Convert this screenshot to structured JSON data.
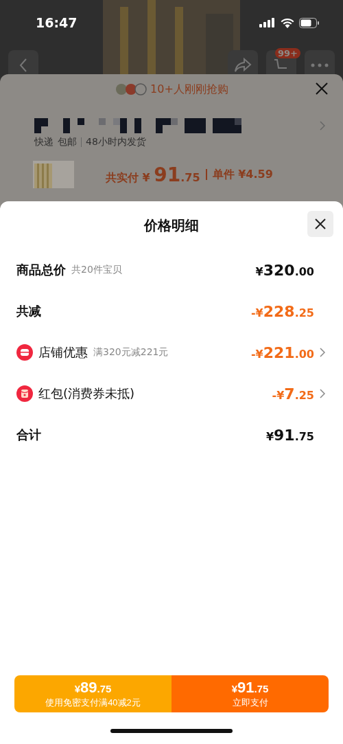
{
  "status_bar": {
    "time": "16:47"
  },
  "nav": {
    "cart_badge": "99+"
  },
  "background_sheet": {
    "social_proof": "10+人刚刚抢购",
    "tags": [
      "快递",
      "包邮"
    ],
    "shipping": "48小时内发货",
    "price_label": "共实付",
    "price": {
      "prefix": "¥",
      "integer": "91",
      "decimal": ".75"
    },
    "unit_label": "单件",
    "unit_price": "¥4.59"
  },
  "sheet": {
    "title": "价格明细",
    "rows": [
      {
        "kind": "plain",
        "label": "商品总价",
        "note": "共20件宝贝",
        "amount": {
          "prefix": "¥",
          "integer": "320",
          "decimal": ".00"
        },
        "highlight": false,
        "chevron": false
      },
      {
        "kind": "plain",
        "label": "共减",
        "amount": {
          "prefix": "-¥",
          "integer": "228",
          "decimal": ".25"
        },
        "highlight": true,
        "chevron": false
      },
      {
        "kind": "store",
        "label": "店铺优惠",
        "note": "满320元减221元",
        "amount": {
          "prefix": "-¥",
          "integer": "221",
          "decimal": ".00"
        },
        "highlight": true,
        "chevron": true
      },
      {
        "kind": "redpacket",
        "label": "红包(消费券未抵)",
        "amount": {
          "prefix": "-¥",
          "integer": "7",
          "decimal": ".25"
        },
        "highlight": true,
        "chevron": true
      },
      {
        "kind": "plain",
        "label": "合计",
        "amount": {
          "prefix": "¥",
          "integer": "91",
          "decimal": ".75"
        },
        "highlight": false,
        "chevron": false
      }
    ]
  },
  "buttons": [
    {
      "kind": "secondary",
      "price": {
        "prefix": "¥",
        "integer": "89",
        "decimal": ".75"
      },
      "label": "使用免密支付满40减2元"
    },
    {
      "kind": "primary",
      "price": {
        "prefix": "¥",
        "integer": "91",
        "decimal": ".75"
      },
      "label": "立即支付"
    }
  ]
}
